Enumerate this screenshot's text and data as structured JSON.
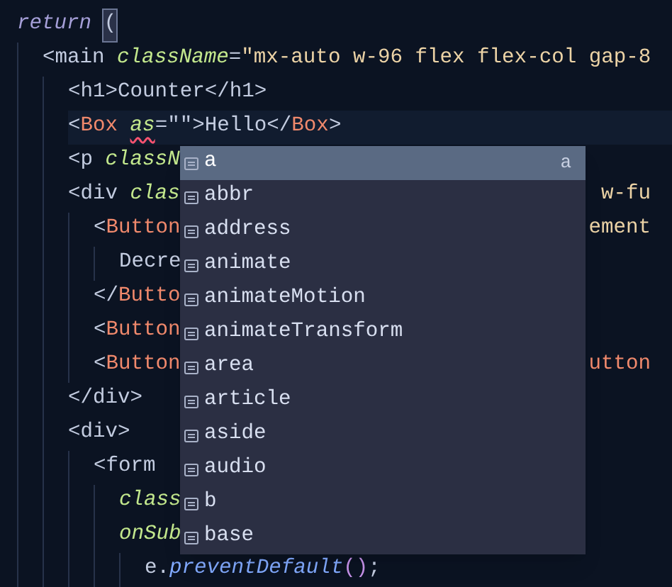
{
  "editor": {
    "lines": [
      {
        "tokens": [
          {
            "text": "return ",
            "kind": "keyword"
          },
          {
            "text": "(",
            "kind": "punct",
            "matched": true
          }
        ],
        "children": [
          {
            "tokens": [
              {
                "text": "<main ",
                "kind": "tag"
              },
              {
                "text": "className",
                "kind": "attr"
              },
              {
                "text": "=",
                "kind": "tag"
              },
              {
                "text": "\"mx-auto w-96 flex flex-col gap-8",
                "kind": "string"
              }
            ],
            "children": [
              {
                "tokens": [
                  {
                    "text": "<h1>Counter</h1>",
                    "kind": "tag"
                  }
                ]
              },
              {
                "current": true,
                "tokens": [
                  {
                    "text": "<",
                    "kind": "tag"
                  },
                  {
                    "text": "Box ",
                    "kind": "component"
                  },
                  {
                    "text": "as",
                    "kind": "attr",
                    "error": true
                  },
                  {
                    "text": "=\"\">Hello</",
                    "kind": "tag"
                  },
                  {
                    "text": "Box",
                    "kind": "component"
                  },
                  {
                    "text": ">",
                    "kind": "tag"
                  }
                ]
              },
              {
                "tokens": [
                  {
                    "text": "<p ",
                    "kind": "tag"
                  },
                  {
                    "text": "classN",
                    "kind": "attr"
                  }
                ]
              },
              {
                "tokens": [
                  {
                    "text": "<div ",
                    "kind": "tag"
                  },
                  {
                    "text": "clas",
                    "kind": "attr"
                  }
                ],
                "right_tokens": [
                  {
                    "text": "w-fu",
                    "kind": "string"
                  }
                ],
                "children": [
                  {
                    "tokens": [
                      {
                        "text": "<",
                        "kind": "tag"
                      },
                      {
                        "text": "Button",
                        "kind": "component"
                      }
                    ],
                    "right_tokens": [
                      {
                        "text": "ement",
                        "kind": "string"
                      }
                    ],
                    "children": [
                      {
                        "tokens": [
                          {
                            "text": "Decre",
                            "kind": "tag"
                          }
                        ]
                      }
                    ]
                  },
                  {
                    "tokens": [
                      {
                        "text": "</",
                        "kind": "tag"
                      },
                      {
                        "text": "Butto",
                        "kind": "component"
                      }
                    ]
                  },
                  {
                    "tokens": [
                      {
                        "text": "<",
                        "kind": "tag"
                      },
                      {
                        "text": "Button",
                        "kind": "component"
                      }
                    ]
                  },
                  {
                    "tokens": [
                      {
                        "text": "<",
                        "kind": "tag"
                      },
                      {
                        "text": "Button",
                        "kind": "component"
                      }
                    ],
                    "right_tokens": [
                      {
                        "text": "utton",
                        "kind": "component"
                      }
                    ]
                  }
                ]
              },
              {
                "tokens": [
                  {
                    "text": "</div>",
                    "kind": "tag"
                  }
                ]
              },
              {
                "tokens": [
                  {
                    "text": "<div>",
                    "kind": "tag"
                  }
                ],
                "children": [
                  {
                    "tokens": [
                      {
                        "text": "<form",
                        "kind": "tag"
                      }
                    ],
                    "children": [
                      {
                        "tokens": [
                          {
                            "text": "class",
                            "kind": "attr"
                          }
                        ]
                      },
                      {
                        "tokens": [
                          {
                            "text": "onSub",
                            "kind": "attr"
                          }
                        ],
                        "children": [
                          {
                            "tokens": [
                              {
                                "text": "e.",
                                "kind": "tag"
                              },
                              {
                                "text": "preventDefault",
                                "kind": "function"
                              },
                              {
                                "text": "()",
                                "kind": "paren"
                              },
                              {
                                "text": ";",
                                "kind": "tag"
                              }
                            ]
                          }
                        ]
                      }
                    ]
                  }
                ]
              }
            ]
          }
        ]
      }
    ]
  },
  "suggestions": [
    {
      "label": "a",
      "selected": true,
      "detail": "a"
    },
    {
      "label": "abbr",
      "selected": false
    },
    {
      "label": "address",
      "selected": false
    },
    {
      "label": "animate",
      "selected": false
    },
    {
      "label": "animateMotion",
      "selected": false
    },
    {
      "label": "animateTransform",
      "selected": false
    },
    {
      "label": "area",
      "selected": false
    },
    {
      "label": "article",
      "selected": false
    },
    {
      "label": "aside",
      "selected": false
    },
    {
      "label": "audio",
      "selected": false
    },
    {
      "label": "b",
      "selected": false
    },
    {
      "label": "base",
      "selected": false
    }
  ]
}
